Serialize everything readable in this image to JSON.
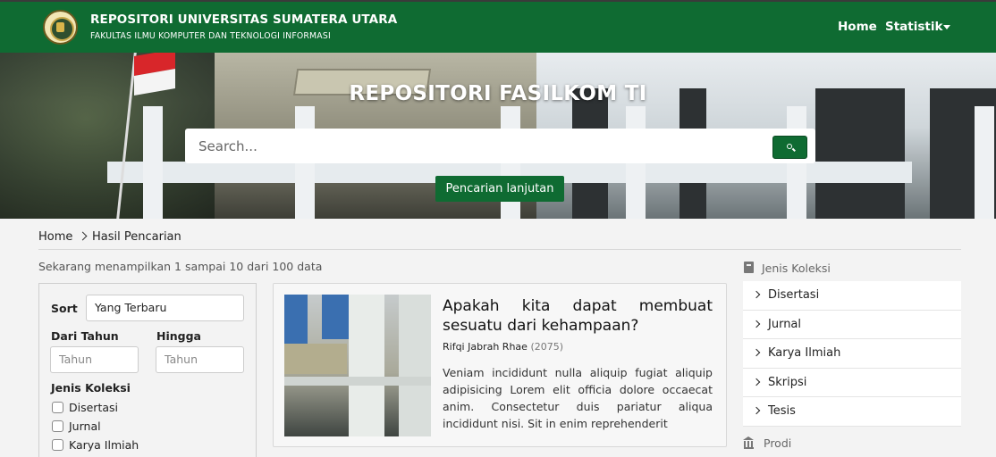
{
  "header": {
    "title": "REPOSITORI UNIVERSITAS SUMATERA UTARA",
    "subtitle": "FAKULTAS ILMU KOMPUTER DAN TEKNOLOGI INFORMASI",
    "nav": {
      "home": "Home",
      "statistik": "Statistik"
    },
    "color": "#0f6b32"
  },
  "hero": {
    "title": "REPOSITORI FASILKOM TI",
    "search_placeholder": "Search...",
    "advanced_label": "Pencarian lanjutan"
  },
  "breadcrumb": {
    "home": "Home",
    "current": "Hasil Pencarian"
  },
  "results": {
    "count_text": "Sekarang menampilkan 1 sampai 10 dari 100 data"
  },
  "filter": {
    "sort_label": "Sort",
    "sort_value": "Yang Terbaru",
    "from_label": "Dari Tahun",
    "to_label": "Hingga",
    "from_placeholder": "Tahun",
    "to_placeholder": "Tahun",
    "collection_label": "Jenis Koleksi",
    "options": [
      "Disertasi",
      "Jurnal",
      "Karya Ilmiah"
    ]
  },
  "card": {
    "title": "Apakah kita dapat membuat sesuatu dari kehampaan?",
    "author": "Rifqi Jabrah Rhae",
    "year": "(2075)",
    "abstract": "Veniam incididunt nulla aliquip fugiat aliquip adipisicing Lorem elit officia dolore occaecat anim. Consectetur duis pariatur aliqua incididunt nisi. Sit in enim reprehenderit"
  },
  "sidebar": {
    "collection_heading": "Jenis Koleksi",
    "items": [
      {
        "label": "Disertasi"
      },
      {
        "label": "Jurnal"
      },
      {
        "label": "Karya Ilmiah"
      },
      {
        "label": "Skripsi"
      },
      {
        "label": "Tesis"
      }
    ],
    "prodi_heading": "Prodi"
  }
}
